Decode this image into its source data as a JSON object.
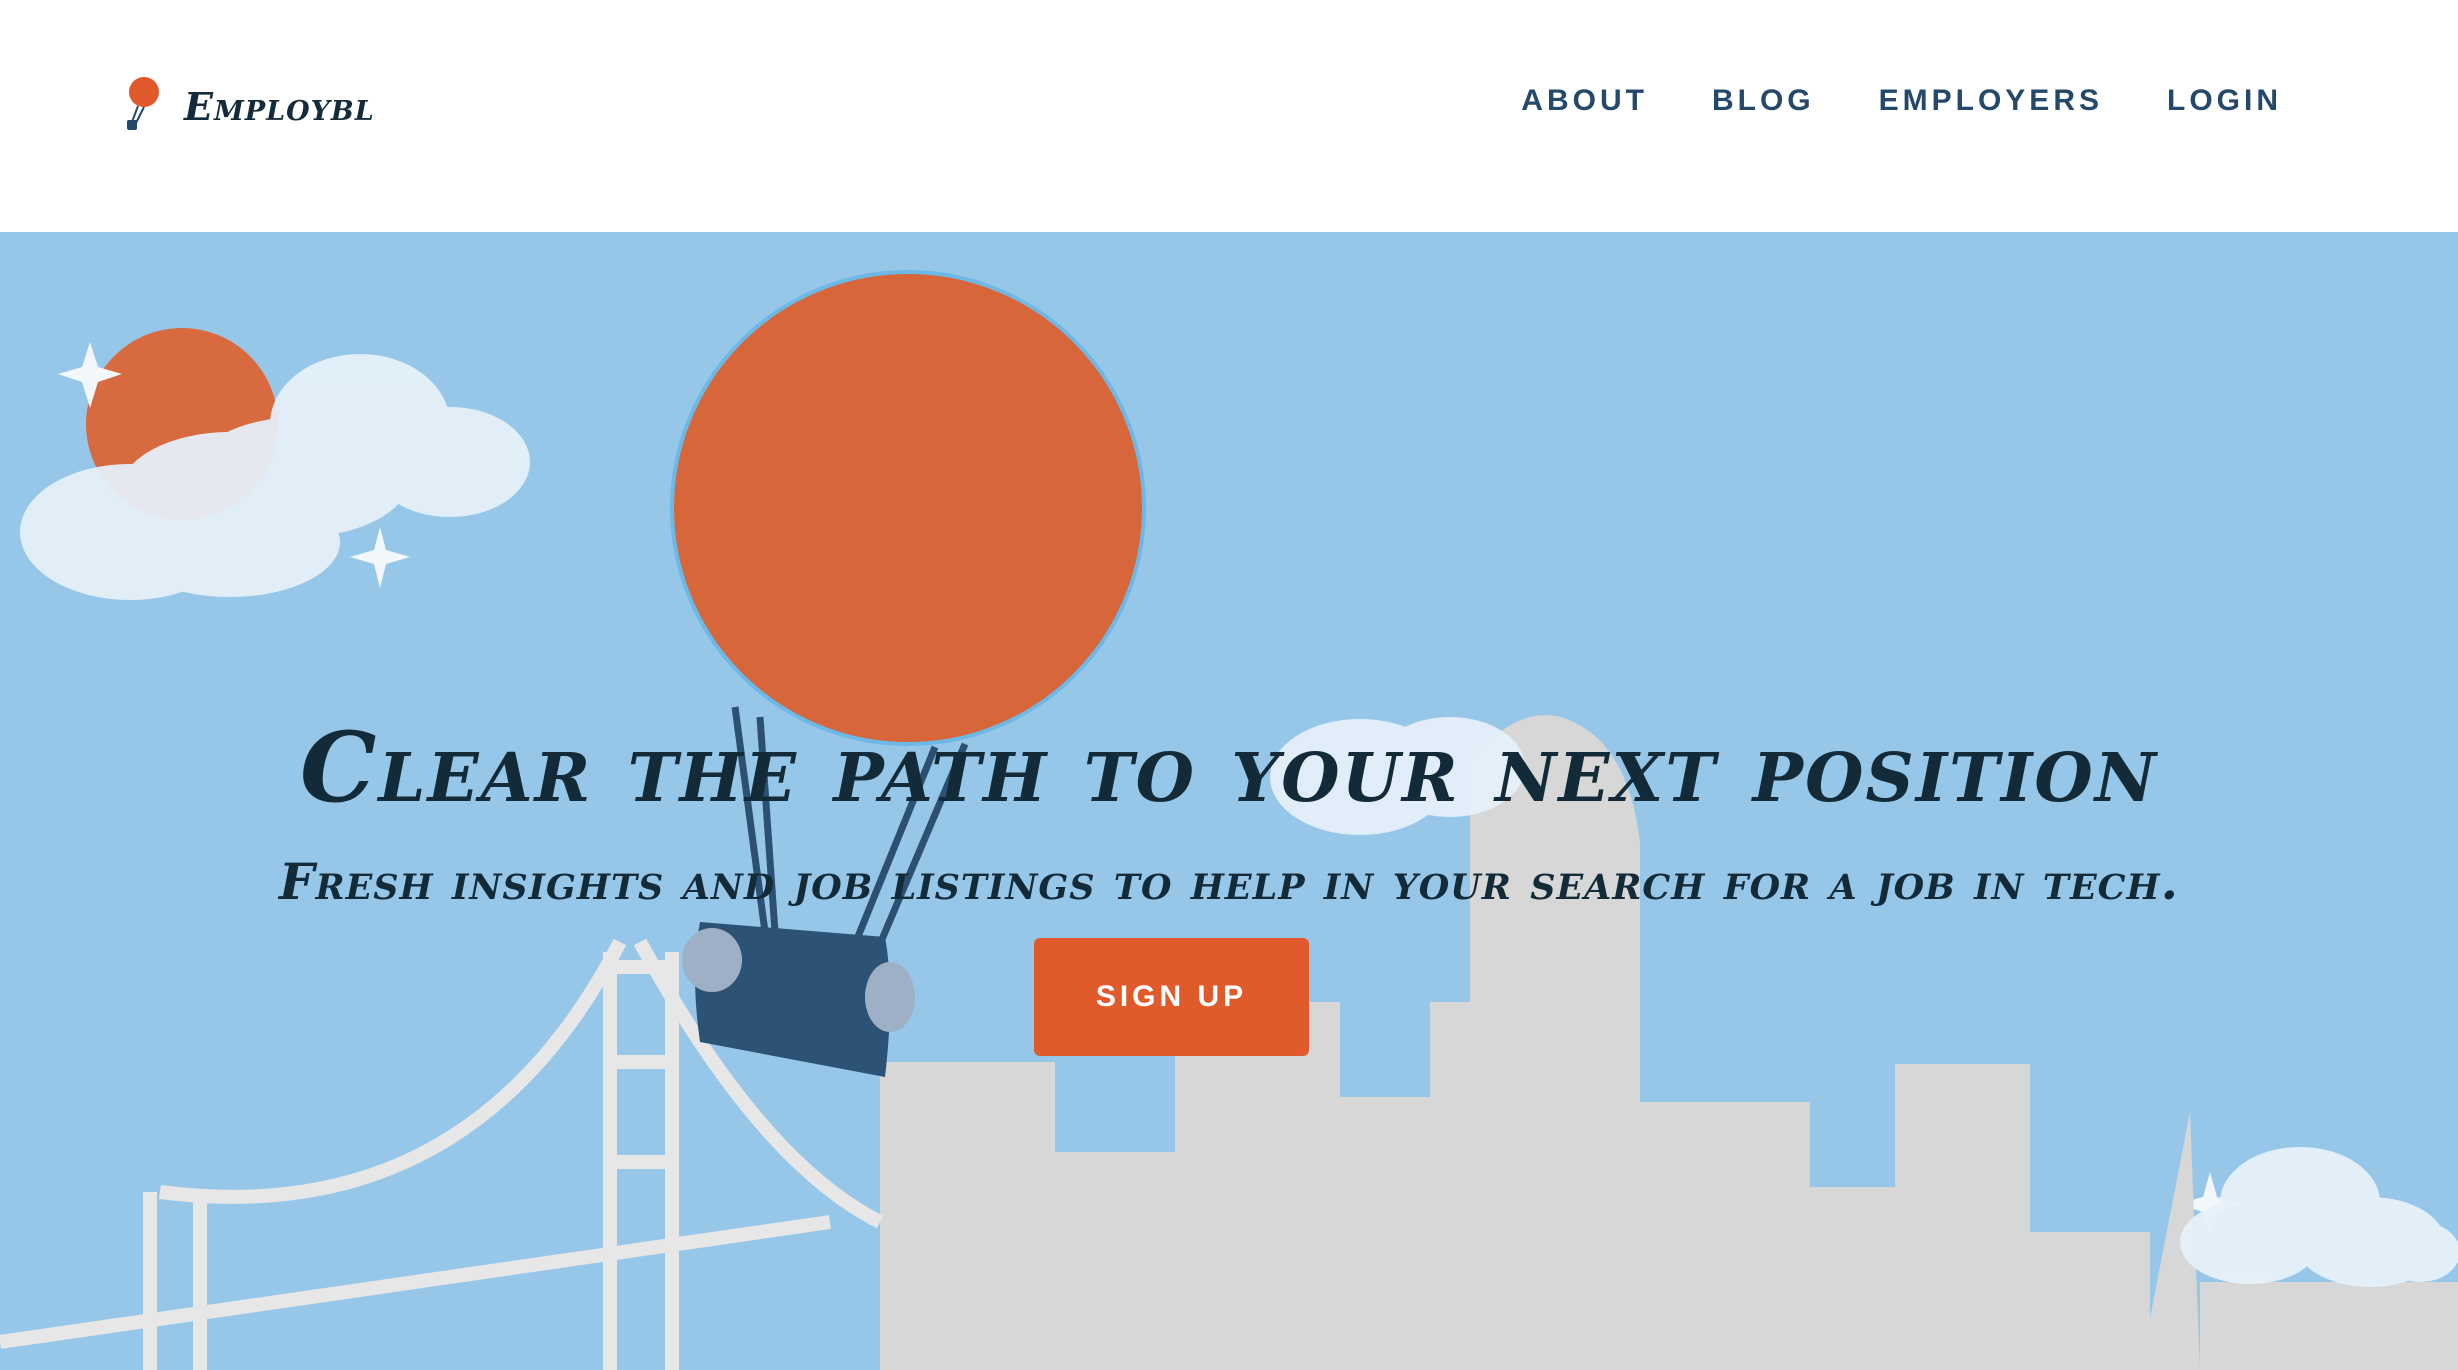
{
  "brand": {
    "name": "Employbl",
    "icon": "balloon-icon",
    "color": "#e05a2b"
  },
  "nav": {
    "items": [
      {
        "label": "ABOUT"
      },
      {
        "label": "BLOG"
      },
      {
        "label": "EMPLOYERS"
      },
      {
        "label": "LOGIN"
      }
    ]
  },
  "hero": {
    "headline": "Clear the path to your next position",
    "subheadline": "Fresh insights and job listings to help in your search for a job in tech.",
    "cta_label": "SIGN UP",
    "colors": {
      "sky": "#97c7e8",
      "balloon": "#d7663b",
      "cta": "#e05a2b",
      "text": "#132b39",
      "city": "#d7d7d7"
    }
  }
}
